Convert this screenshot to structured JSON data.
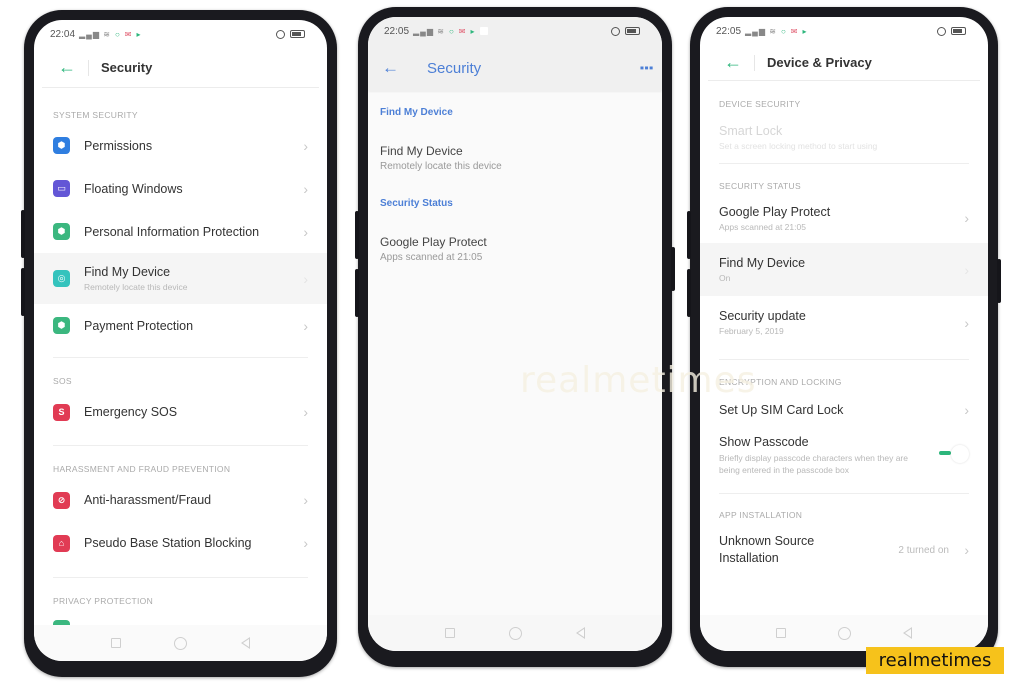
{
  "phone1": {
    "status": {
      "time": "22:04"
    },
    "header": {
      "title": "Security",
      "back_icon": "back-arrow-icon"
    },
    "sections": {
      "system_security": "SYSTEM SECURITY",
      "sos": "SOS",
      "harassment": "HARASSMENT AND FRAUD PREVENTION",
      "privacy": "PRIVACY PROTECTION"
    },
    "items": [
      {
        "label": "Permissions",
        "icon": "shield-icon",
        "color": "#2f7ee0"
      },
      {
        "label": "Floating Windows",
        "icon": "window-icon",
        "color": "#6356d6"
      },
      {
        "label": "Personal Information Protection",
        "icon": "lock-shield-icon",
        "color": "#3bb77f"
      },
      {
        "label": "Find My Device",
        "sub": "Remotely locate this device",
        "icon": "locate-icon",
        "color": "#34c3bd"
      },
      {
        "label": "Payment Protection",
        "icon": "payment-shield-icon",
        "color": "#3bb77f"
      },
      {
        "label": "Emergency SOS",
        "icon": "sos-icon",
        "glyph": "S",
        "color": "#e13b54"
      },
      {
        "label": "Anti-harassment/Fraud",
        "icon": "block-icon",
        "color": "#e13b54"
      },
      {
        "label": "Pseudo Base Station Blocking",
        "icon": "tower-icon",
        "color": "#e13b54"
      }
    ]
  },
  "phone2": {
    "status": {
      "time": "22:05"
    },
    "header": {
      "title": "Security",
      "back_icon": "back-arrow-icon",
      "more_icon": "more-vert-icon"
    },
    "categories": {
      "find": "Find My Device",
      "status": "Security Status"
    },
    "items": [
      {
        "label": "Find My Device",
        "sub": "Remotely locate this device"
      },
      {
        "label": "Google Play Protect",
        "sub": "Apps scanned at 21:05"
      }
    ]
  },
  "phone3": {
    "status": {
      "time": "22:05"
    },
    "header": {
      "title": "Device & Privacy"
    },
    "sections": {
      "device_security": "DEVICE SECURITY",
      "security_status": "SECURITY STATUS",
      "encryption": "ENCRYPTION AND LOCKING",
      "app_install": "APP INSTALLATION"
    },
    "smart_lock": {
      "label": "Smart Lock",
      "sub": "Set a screen locking method to start using"
    },
    "play_protect": {
      "label": "Google Play Protect",
      "sub": "Apps scanned at 21:05"
    },
    "find_device": {
      "label": "Find My Device",
      "sub": "On"
    },
    "security_update": {
      "label": "Security update",
      "sub": "February 5, 2019"
    },
    "sim_lock": {
      "label": "Set Up SIM Card Lock"
    },
    "show_passcode": {
      "label": "Show Passcode",
      "sub": "Briefly display passcode characters when they are being entered in the passcode box",
      "enabled": true
    },
    "unknown_source": {
      "label": "Unknown Source Installation",
      "value": "2 turned on"
    }
  },
  "watermark": "realmetimes",
  "brand": "realmetimes",
  "chevron": "›",
  "colors": {
    "accent_green": "#2db67c",
    "accent_blue": "#4c7fd6",
    "brand_yellow": "#f6c21b"
  }
}
